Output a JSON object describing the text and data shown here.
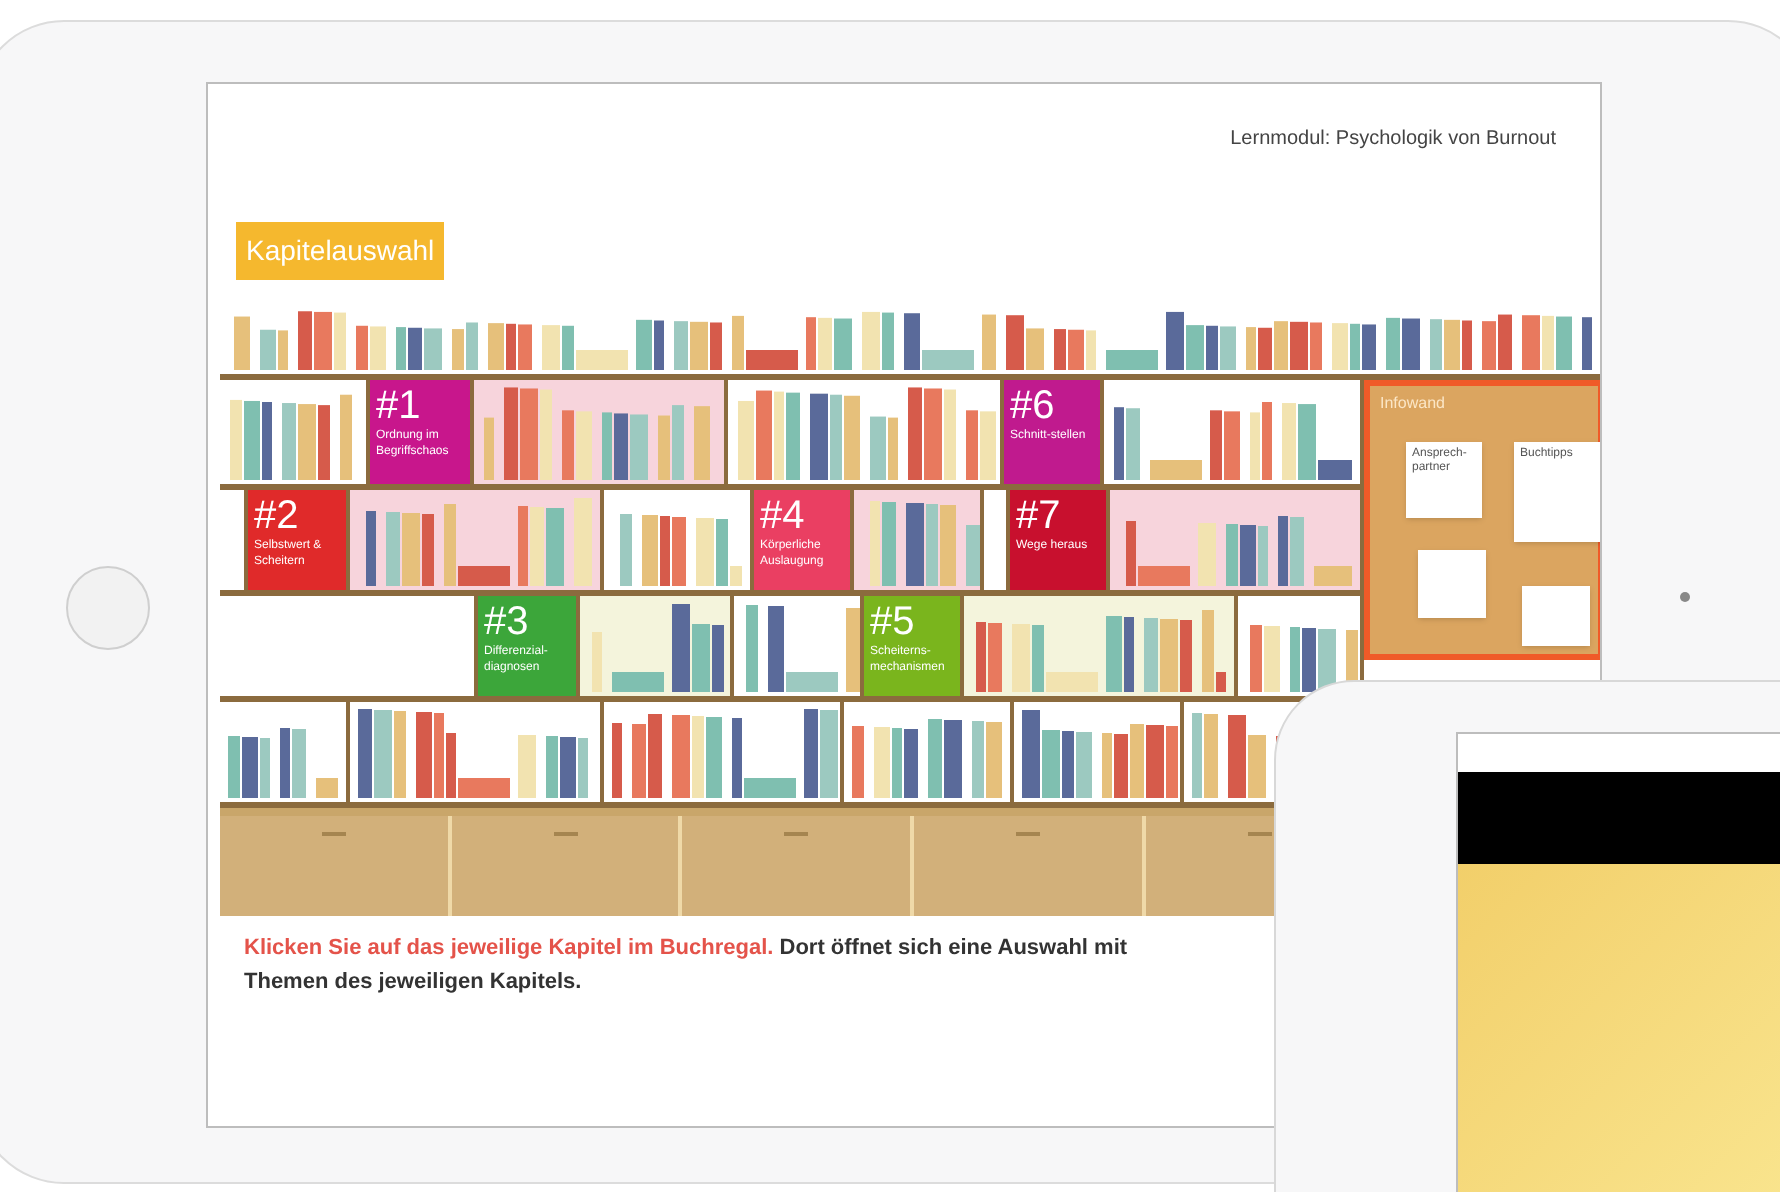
{
  "header": {
    "module_title": "Lernmodul: Psychologik von Burnout"
  },
  "section_title": "Kapitelauswahl",
  "shelves": [
    {
      "slots": [
        {
          "kind": "books",
          "color": "#ffffff"
        }
      ]
    },
    {
      "slots": [
        {
          "kind": "books",
          "color": "#ffffff"
        },
        {
          "kind": "chapter",
          "number": "#1",
          "title": "Ordnung im Begriffschaos",
          "color": "#c8168c"
        },
        {
          "kind": "books",
          "color": "#f7d4dc"
        },
        {
          "kind": "books",
          "color": "#ffffff"
        },
        {
          "kind": "chapter",
          "number": "#6",
          "title": "Schnitt-stellen",
          "color": "#c01a8e"
        },
        {
          "kind": "books",
          "color": "#ffffff"
        }
      ]
    },
    {
      "slots": [
        {
          "kind": "empty",
          "color": "#ffffff"
        },
        {
          "kind": "chapter",
          "number": "#2",
          "title": "Selbstwert & Scheitern",
          "color": "#e02a2a"
        },
        {
          "kind": "books",
          "color": "#f7d4dc"
        },
        {
          "kind": "books",
          "color": "#ffffff"
        },
        {
          "kind": "chapter",
          "number": "#4",
          "title": "Körperliche Auslaugung",
          "color": "#ea3f62"
        },
        {
          "kind": "books",
          "color": "#f7d4dc"
        },
        {
          "kind": "empty",
          "color": "#ffffff"
        },
        {
          "kind": "chapter",
          "number": "#7",
          "title": "Wege heraus",
          "color": "#c8102e"
        },
        {
          "kind": "books",
          "color": "#f7d4dc"
        }
      ]
    },
    {
      "slots": [
        {
          "kind": "empty",
          "color": "#ffffff"
        },
        {
          "kind": "chapter",
          "number": "#3",
          "title": "Differenzial-diagnosen",
          "color": "#3ca63a"
        },
        {
          "kind": "books",
          "color": "#f4f4dc"
        },
        {
          "kind": "books",
          "color": "#ffffff"
        },
        {
          "kind": "chapter",
          "number": "#5",
          "title": "Scheiterns-mechanismen",
          "color": "#7ab51d"
        },
        {
          "kind": "books",
          "color": "#f4f4dc"
        },
        {
          "kind": "books",
          "color": "#ffffff"
        }
      ]
    },
    {
      "slots": [
        {
          "kind": "books",
          "color": "#ffffff"
        },
        {
          "kind": "books",
          "color": "#ffffff"
        },
        {
          "kind": "books",
          "color": "#ffffff"
        },
        {
          "kind": "books",
          "color": "#ffffff"
        },
        {
          "kind": "books",
          "color": "#ffffff"
        },
        {
          "kind": "books",
          "color": "#ffffff"
        }
      ]
    }
  ],
  "infowand": {
    "title": "Infowand",
    "notes": [
      {
        "kind": "text",
        "text": "Ansprech-partner"
      },
      {
        "kind": "text",
        "text": "Buchtipps"
      },
      {
        "kind": "blank"
      },
      {
        "kind": "blank"
      }
    ]
  },
  "instruction": {
    "highlight": "Klicken Sie auf das jeweilige Kapitel im Buchregal.",
    "text": " Dort öffnet sich eine Auswahl mit Themen des jeweiligen Kapitels."
  }
}
